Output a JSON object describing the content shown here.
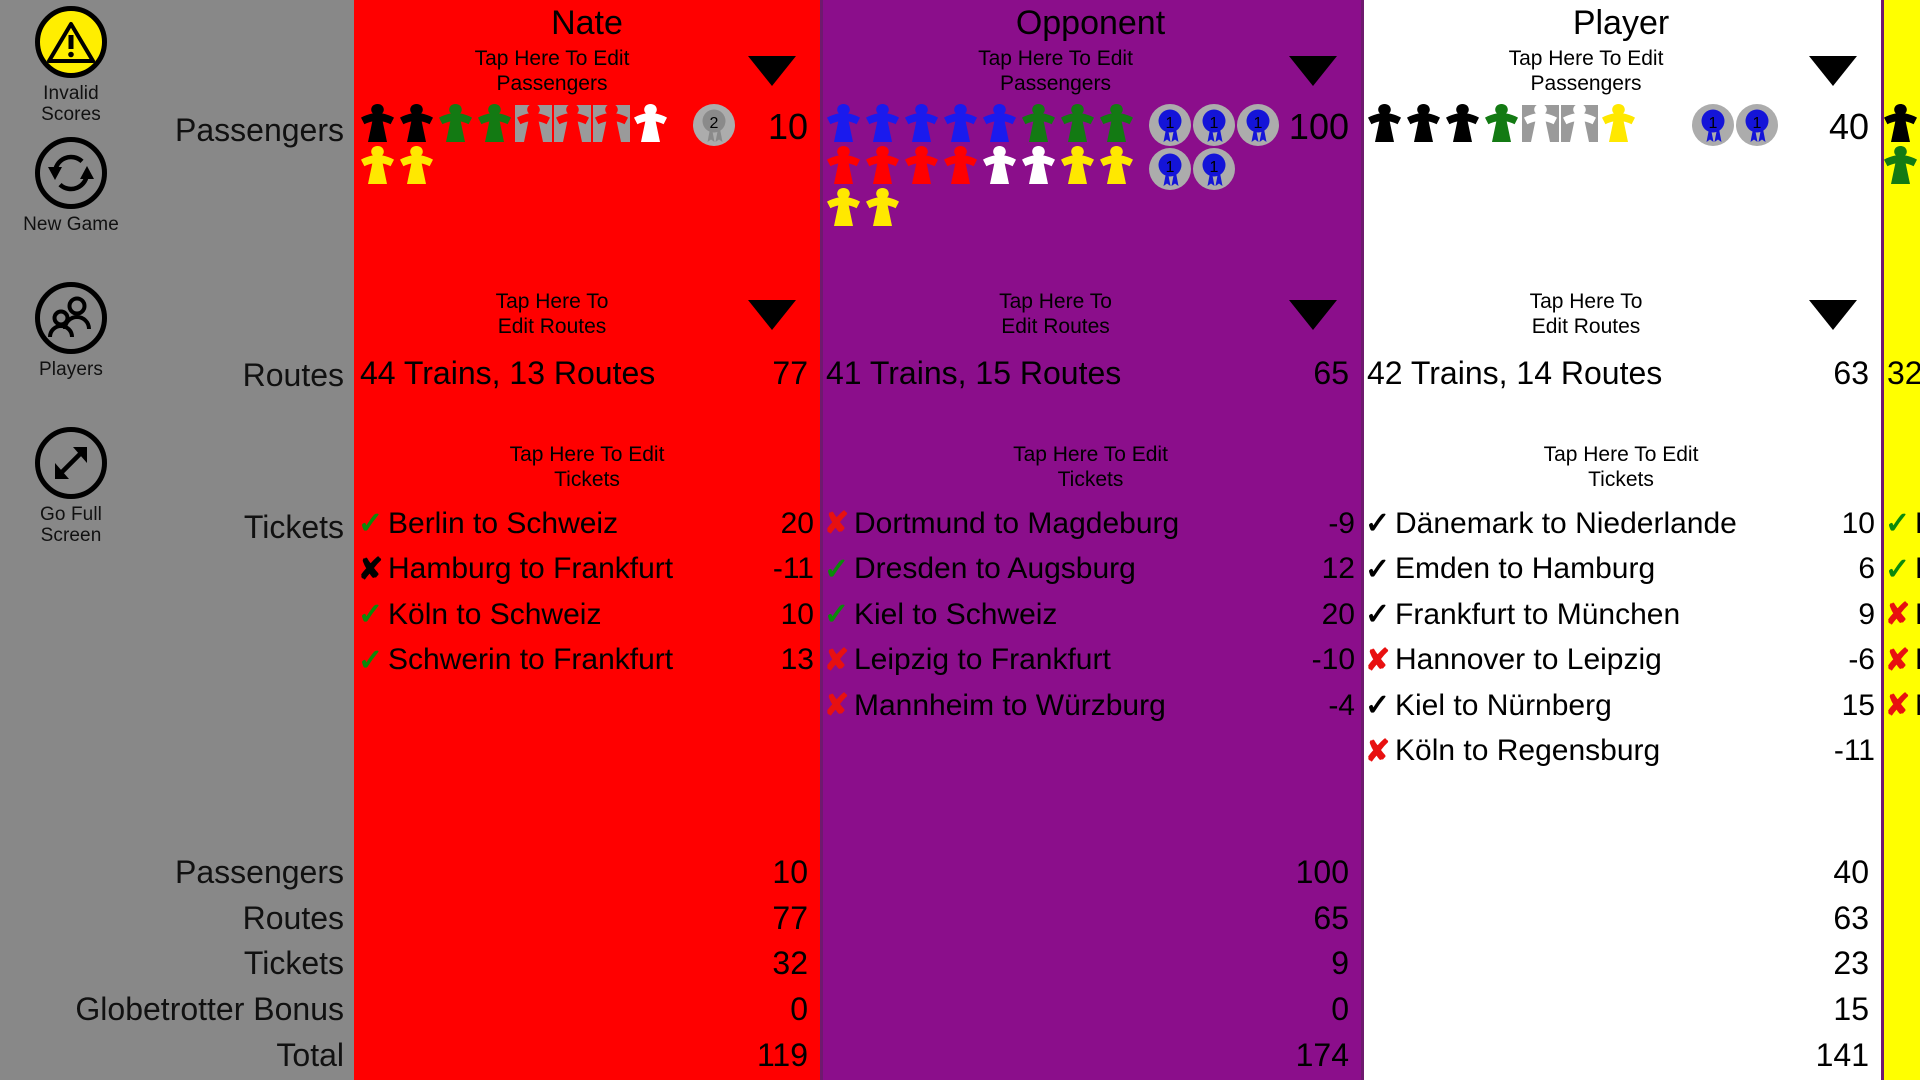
{
  "sidebar": {
    "items": [
      {
        "label": "Invalid\nScores",
        "label_line1": "Invalid",
        "label_line2": "Scores",
        "icon": "warning-triangle-icon"
      },
      {
        "label": "New Game",
        "label_line1": "New Game",
        "label_line2": "",
        "icon": "refresh-circular-arrows-icon"
      },
      {
        "label": "Players",
        "label_line1": "Players",
        "label_line2": "",
        "icon": "people-group-icon"
      },
      {
        "label": "Go Full\nScreen",
        "label_line1": "Go Full",
        "label_line2": "Screen",
        "icon": "expand-diagonal-arrow-icon"
      }
    ]
  },
  "row_labels": {
    "passengers": "Passengers",
    "routes": "Routes",
    "tickets": "Tickets",
    "sum_passengers": "Passengers",
    "sum_routes": "Routes",
    "sum_tickets": "Tickets",
    "sum_globetrotter": "Globetrotter Bonus",
    "sum_total": "Total"
  },
  "tap_labels": {
    "passengers_l1": "Tap Here To Edit",
    "passengers_l2": "Passengers",
    "routes_l1": "Tap Here To",
    "routes_l2": "Edit Routes",
    "tickets_l1": "Tap Here To Edit",
    "tickets_l2": "Tickets"
  },
  "colors": {
    "nate": "#FF0000",
    "opponent": "#8B0E8B",
    "player": "#FFFFFF",
    "fourth": "#FFFF00",
    "sidebar": "#888888",
    "warning_yellow": "#FFEE00",
    "check_green": "#0B8A0B",
    "x_red": "#E81010",
    "badge_gray": "#ACACAC",
    "badge_blue": "#1414D8"
  },
  "players": [
    {
      "name": "Nate",
      "bg": "#FF0000",
      "passengers_meeples": [
        {
          "color": "#000000",
          "placeholder": false
        },
        {
          "color": "#000000",
          "placeholder": false
        },
        {
          "color": "#137A13",
          "placeholder": false
        },
        {
          "color": "#137A13",
          "placeholder": false
        },
        {
          "color": "#FF0000",
          "placeholder": true
        },
        {
          "color": "#FF0000",
          "placeholder": true
        },
        {
          "color": "#FF0000",
          "placeholder": true
        },
        {
          "color": "#FFFFFF",
          "placeholder": false
        },
        {
          "color": "#FFE800",
          "placeholder": false
        },
        {
          "color": "#FFE800",
          "placeholder": false
        }
      ],
      "badges": [
        {
          "num": "2",
          "color": "gray"
        }
      ],
      "passengers_score": "10",
      "routes_text": "44 Trains, 13 Routes",
      "routes_score": "77",
      "tickets": [
        {
          "status": "check",
          "mark_color": "green",
          "name": "Berlin to Schweiz",
          "points": "20"
        },
        {
          "status": "cross",
          "mark_color": "black",
          "name": "Hamburg to Frankfurt",
          "points": "-11"
        },
        {
          "status": "check",
          "mark_color": "green",
          "name": "Köln to Schweiz",
          "points": "10"
        },
        {
          "status": "check",
          "mark_color": "green",
          "name": "Schwerin to Frankfurt",
          "points": "13"
        }
      ],
      "summary": {
        "passengers": "10",
        "routes": "77",
        "tickets": "32",
        "globetrotter": "0",
        "total": "119"
      }
    },
    {
      "name": "Opponent",
      "bg": "#8B0E8B",
      "passengers_meeples": [
        {
          "color": "#1A1AEE",
          "placeholder": false
        },
        {
          "color": "#1A1AEE",
          "placeholder": false
        },
        {
          "color": "#1A1AEE",
          "placeholder": false
        },
        {
          "color": "#1A1AEE",
          "placeholder": false
        },
        {
          "color": "#1A1AEE",
          "placeholder": false
        },
        {
          "color": "#137A13",
          "placeholder": false
        },
        {
          "color": "#137A13",
          "placeholder": false
        },
        {
          "color": "#137A13",
          "placeholder": false
        },
        {
          "color": "#FF0000",
          "placeholder": false
        },
        {
          "color": "#FF0000",
          "placeholder": false
        },
        {
          "color": "#FF0000",
          "placeholder": false
        },
        {
          "color": "#FF0000",
          "placeholder": false
        },
        {
          "color": "#FFFFFF",
          "placeholder": false
        },
        {
          "color": "#FFFFFF",
          "placeholder": false
        },
        {
          "color": "#FFE800",
          "placeholder": false
        },
        {
          "color": "#FFE800",
          "placeholder": false
        },
        {
          "color": "#FFE800",
          "placeholder": false
        },
        {
          "color": "#FFE800",
          "placeholder": false
        }
      ],
      "badges": [
        {
          "num": "1",
          "color": "blue"
        },
        {
          "num": "1",
          "color": "blue"
        },
        {
          "num": "1",
          "color": "blue"
        },
        {
          "num": "1",
          "color": "blue"
        },
        {
          "num": "1",
          "color": "blue"
        }
      ],
      "passengers_score": "100",
      "routes_text": "41 Trains, 15 Routes",
      "routes_score": "65",
      "tickets": [
        {
          "status": "cross",
          "mark_color": "red",
          "name": "Dortmund to Magdeburg",
          "points": "-9"
        },
        {
          "status": "check",
          "mark_color": "green",
          "name": "Dresden to Augsburg",
          "points": "12"
        },
        {
          "status": "check",
          "mark_color": "green",
          "name": "Kiel to Schweiz",
          "points": "20"
        },
        {
          "status": "cross",
          "mark_color": "red",
          "name": "Leipzig to Frankfurt",
          "points": "-10"
        },
        {
          "status": "cross",
          "mark_color": "red",
          "name": "Mannheim to Würzburg",
          "points": "-4"
        }
      ],
      "summary": {
        "passengers": "100",
        "routes": "65",
        "tickets": "9",
        "globetrotter": "0",
        "total": "174"
      }
    },
    {
      "name": "Player",
      "bg": "#FFFFFF",
      "passengers_meeples": [
        {
          "color": "#000000",
          "placeholder": false
        },
        {
          "color": "#000000",
          "placeholder": false
        },
        {
          "color": "#000000",
          "placeholder": false
        },
        {
          "color": "#137A13",
          "placeholder": false
        },
        {
          "color": "#FFFFFF",
          "placeholder": true
        },
        {
          "color": "#FFFFFF",
          "placeholder": true
        },
        {
          "color": "#FFE800",
          "placeholder": false
        }
      ],
      "badges": [
        {
          "num": "1",
          "color": "blue"
        },
        {
          "num": "1",
          "color": "blue"
        }
      ],
      "passengers_score": "40",
      "routes_text": "42 Trains, 14 Routes",
      "routes_score": "63",
      "tickets": [
        {
          "status": "check",
          "mark_color": "black",
          "name": "Dänemark to Niederlande",
          "points": "10"
        },
        {
          "status": "check",
          "mark_color": "black",
          "name": "Emden to Hamburg",
          "points": "6"
        },
        {
          "status": "check",
          "mark_color": "black",
          "name": "Frankfurt to München",
          "points": "9"
        },
        {
          "status": "cross",
          "mark_color": "red",
          "name": "Hannover to Leipzig",
          "points": "-6"
        },
        {
          "status": "check",
          "mark_color": "black",
          "name": "Kiel to Nürnberg",
          "points": "15"
        },
        {
          "status": "cross",
          "mark_color": "red",
          "name": "Köln to Regensburg",
          "points": "-11"
        }
      ],
      "summary": {
        "passengers": "40",
        "routes": "63",
        "tickets": "23",
        "globetrotter": "15",
        "total": "141"
      }
    },
    {
      "name": "",
      "bg": "#FFFF00",
      "passengers_meeples": [
        {
          "color": "#000000",
          "placeholder": false
        },
        {
          "color": "#000000",
          "placeholder": false
        },
        {
          "color": "#137A13",
          "placeholder": false
        },
        {
          "color": "#137A13",
          "placeholder": false
        }
      ],
      "badges": [],
      "passengers_score": "",
      "routes_text": "",
      "routes_score": "32",
      "tickets": [
        {
          "status": "check",
          "mark_color": "green",
          "name": "B",
          "points": ""
        },
        {
          "status": "check",
          "mark_color": "green",
          "name": "E",
          "points": ""
        },
        {
          "status": "cross",
          "mark_color": "red",
          "name": "H",
          "points": ""
        },
        {
          "status": "cross",
          "mark_color": "red",
          "name": "K",
          "points": ""
        },
        {
          "status": "cross",
          "mark_color": "red",
          "name": "M",
          "points": ""
        }
      ],
      "summary": {
        "passengers": "",
        "routes": "",
        "tickets": "",
        "globetrotter": "",
        "total": ""
      }
    }
  ]
}
